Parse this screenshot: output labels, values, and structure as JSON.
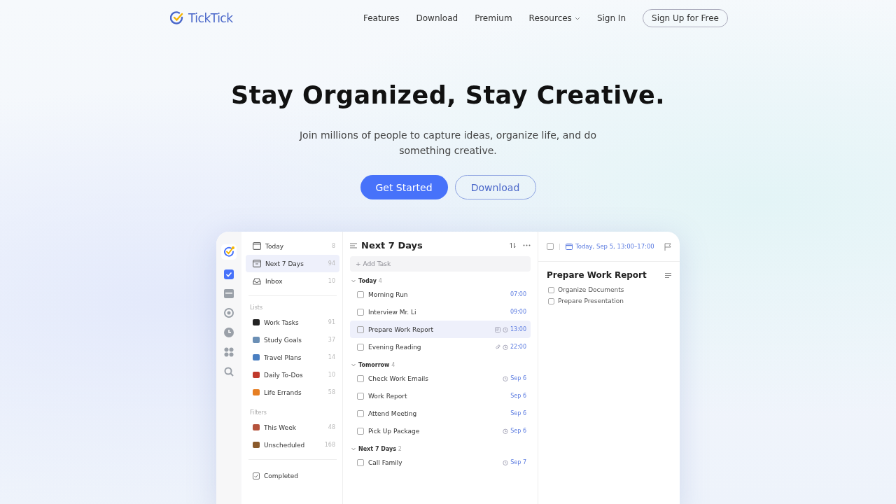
{
  "nav": {
    "brand": "TickTick",
    "links": [
      {
        "label": "Features",
        "dropdown": false
      },
      {
        "label": "Download",
        "dropdown": false
      },
      {
        "label": "Premium",
        "dropdown": false
      },
      {
        "label": "Resources",
        "dropdown": true
      },
      {
        "label": "Sign In",
        "dropdown": false
      }
    ],
    "cta": "Sign Up for Free"
  },
  "hero": {
    "title": "Stay Organized, Stay Creative.",
    "subtitle": "Join millions of people to capture ideas, organize life, and do something creative.",
    "primary": "Get Started",
    "secondary": "Download"
  },
  "app": {
    "rail": [
      {
        "kind": "tasks",
        "selected": true
      },
      {
        "kind": "calendar",
        "selected": false
      },
      {
        "kind": "focus",
        "selected": false
      },
      {
        "kind": "clock",
        "selected": false
      },
      {
        "kind": "apps",
        "selected": false
      },
      {
        "kind": "search",
        "selected": false
      }
    ],
    "smart": [
      {
        "kind": "today",
        "label": "Today",
        "count": "8",
        "selected": false
      },
      {
        "kind": "week",
        "label": "Next 7 Days",
        "count": "94",
        "selected": true
      },
      {
        "kind": "inbox",
        "label": "Inbox",
        "count": "10",
        "selected": false
      }
    ],
    "lists_heading": "Lists",
    "lists": [
      {
        "label": "Work Tasks",
        "count": "91",
        "color": "#222222"
      },
      {
        "label": "Study Goals",
        "count": "37",
        "color": "#6b8fb5"
      },
      {
        "label": "Travel Plans",
        "count": "14",
        "color": "#4a7fc1"
      },
      {
        "label": "Daily To-Dos",
        "count": "10",
        "color": "#c0392b"
      },
      {
        "label": "Life Errands",
        "count": "58",
        "color": "#e67e22"
      }
    ],
    "filters_heading": "Filters",
    "filters": [
      {
        "label": "This Week",
        "count": "48",
        "color": "#b5533c"
      },
      {
        "label": "Unscheduled",
        "count": "168",
        "color": "#8a5a2b"
      }
    ],
    "completed": "Completed",
    "list_title": "Next 7 Days",
    "add_placeholder": "+ Add Task",
    "groups": [
      {
        "title": "Today",
        "count": "4",
        "expanded": true,
        "tasks": [
          {
            "name": "Morning Run",
            "due": "07:00",
            "note": false,
            "attachment": false,
            "alarm": false,
            "selected": false,
            "checked": false
          },
          {
            "name": "Interview Mr. Li",
            "due": "09:00",
            "note": false,
            "attachment": false,
            "alarm": false,
            "selected": false,
            "checked": false
          },
          {
            "name": "Prepare Work Report",
            "due": "13:00",
            "note": true,
            "attachment": false,
            "alarm": true,
            "selected": true,
            "checked": false
          },
          {
            "name": "Evening Reading",
            "due": "22:00",
            "note": false,
            "attachment": true,
            "alarm": true,
            "selected": false,
            "checked": false
          }
        ]
      },
      {
        "title": "Tomorrow",
        "count": "4",
        "expanded": true,
        "tasks": [
          {
            "name": "Check Work Emails",
            "due": "Sep 6",
            "note": false,
            "attachment": false,
            "alarm": true,
            "selected": false,
            "checked": false
          },
          {
            "name": "Work Report",
            "due": "Sep 6",
            "note": false,
            "attachment": false,
            "alarm": false,
            "selected": false,
            "checked": false
          },
          {
            "name": "Attend Meeting",
            "due": "Sep 6",
            "note": false,
            "attachment": false,
            "alarm": false,
            "selected": false,
            "checked": false
          },
          {
            "name": "Pick Up Package",
            "due": "Sep 6",
            "note": false,
            "attachment": false,
            "alarm": true,
            "selected": false,
            "checked": false
          }
        ]
      },
      {
        "title": "Next 7 Days",
        "count": "2",
        "expanded": true,
        "tasks": [
          {
            "name": "Call Family",
            "due": "Sep 7",
            "note": false,
            "attachment": false,
            "alarm": true,
            "selected": false,
            "checked": false
          }
        ]
      }
    ],
    "detail": {
      "checked": false,
      "date": "Today, Sep 5, 13:00–17:00",
      "title": "Prepare Work Report",
      "subtasks": [
        {
          "label": "Organize Documents",
          "checked": false
        },
        {
          "label": "Prepare Presentation",
          "checked": false
        }
      ]
    }
  }
}
